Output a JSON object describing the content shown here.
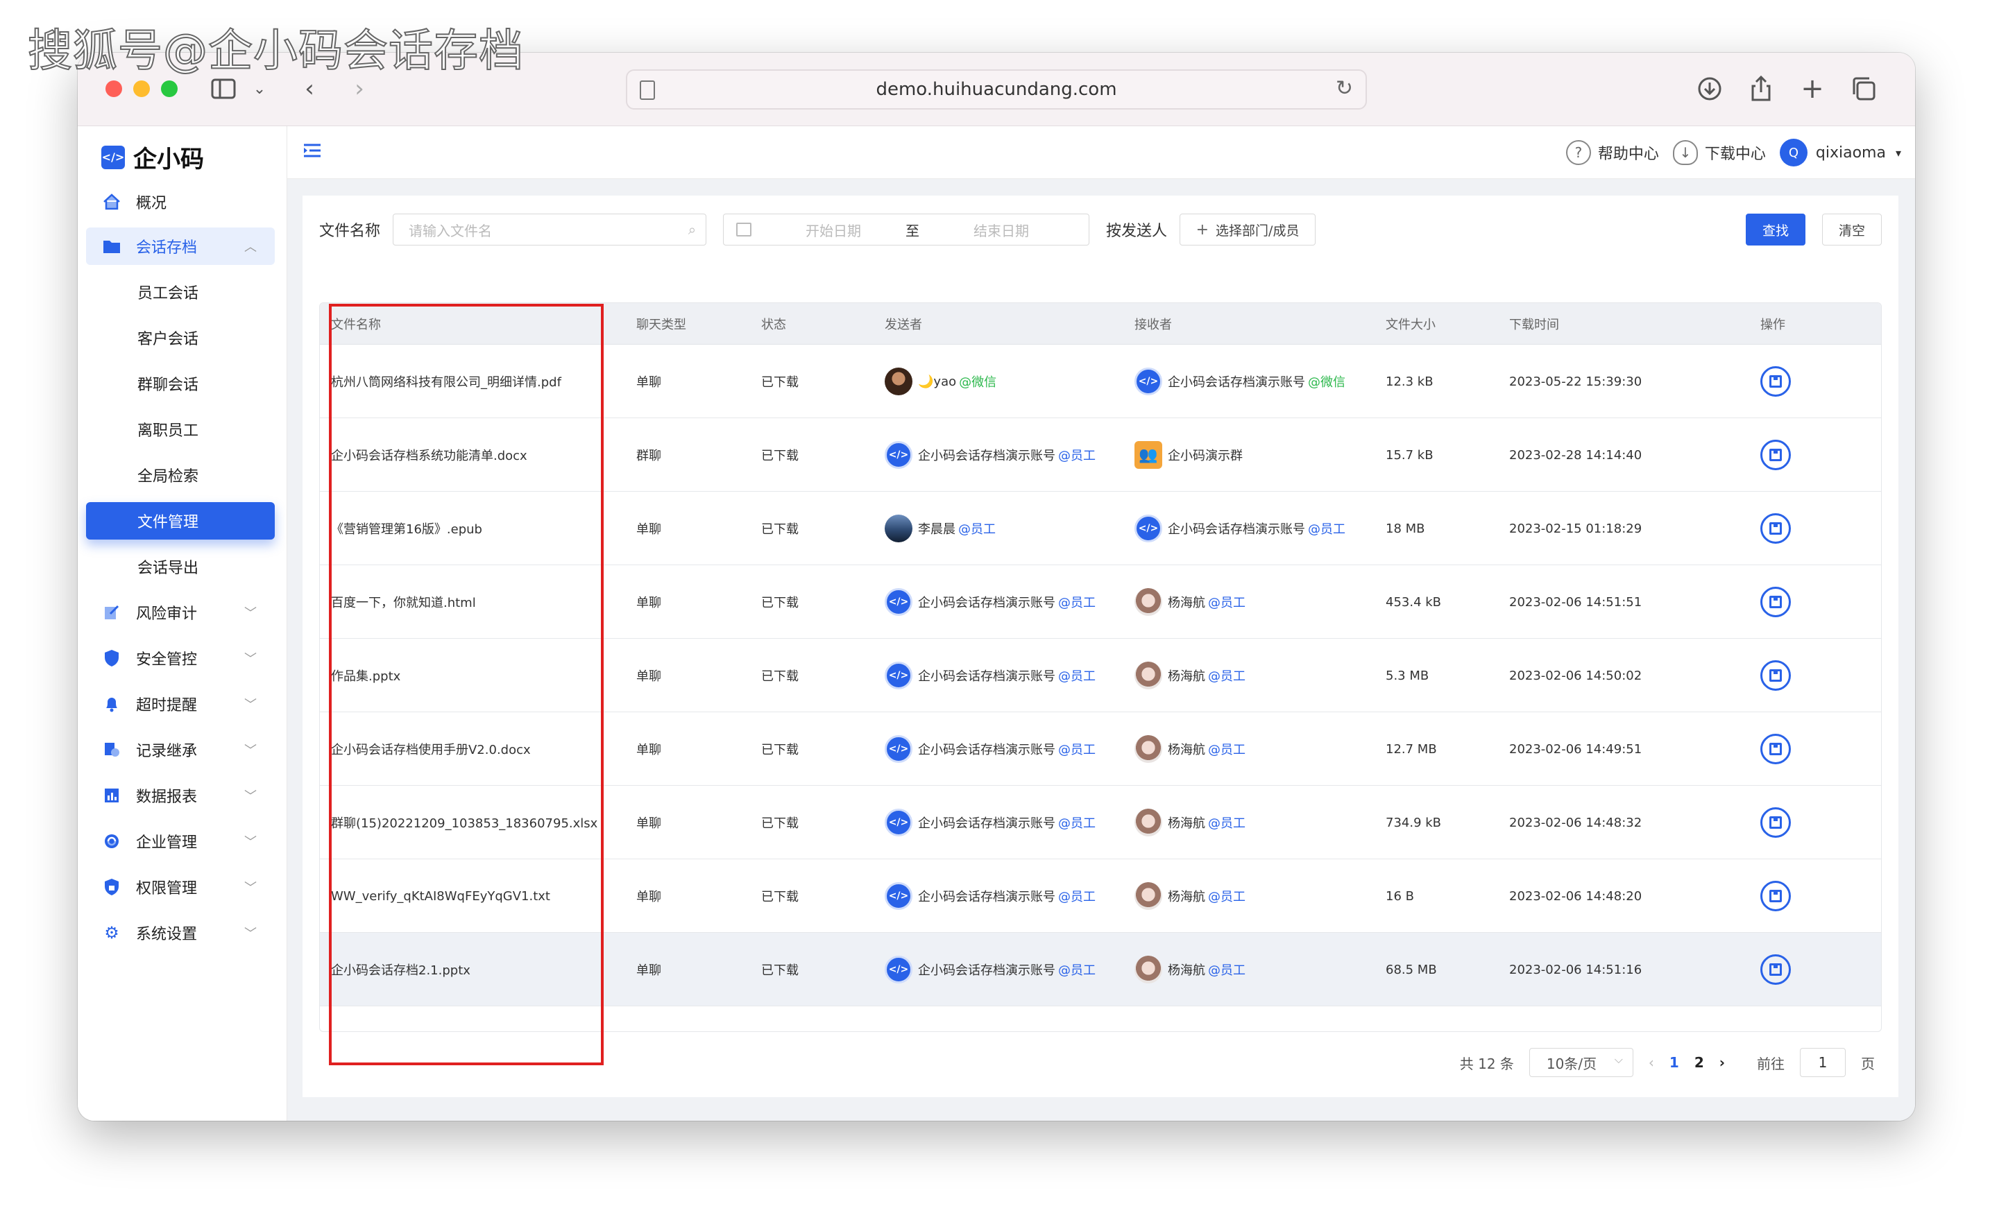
{
  "watermark": "搜狐号@企小码会话存档",
  "browser": {
    "url": "demo.huihuacundang.com",
    "icons": [
      "sidebar-icon",
      "chevron-down-icon",
      "back-icon",
      "forward-icon",
      "download-icon",
      "share-icon",
      "plus-icon",
      "tabs-icon",
      "reload-icon"
    ]
  },
  "app": {
    "logo_text": "企小码",
    "logo_mark": "</>"
  },
  "sidebar": {
    "items": [
      {
        "label": "概况",
        "icon": "home-icon"
      },
      {
        "label": "会话存档",
        "icon": "folder-icon"
      },
      {
        "label": "员工会话"
      },
      {
        "label": "客户会话"
      },
      {
        "label": "群聊会话"
      },
      {
        "label": "离职员工"
      },
      {
        "label": "全局检索"
      },
      {
        "label": "文件管理"
      },
      {
        "label": "会话导出"
      },
      {
        "label": "风险审计",
        "icon": "edit-icon"
      },
      {
        "label": "安全管控",
        "icon": "shield-icon"
      },
      {
        "label": "超时提醒",
        "icon": "bell-icon"
      },
      {
        "label": "记录继承",
        "icon": "transfer-icon"
      },
      {
        "label": "数据报表",
        "icon": "chart-icon"
      },
      {
        "label": "企业管理",
        "icon": "org-icon"
      },
      {
        "label": "权限管理",
        "icon": "lock-icon"
      },
      {
        "label": "系统设置",
        "icon": "gear-icon"
      }
    ]
  },
  "topbar": {
    "help": "帮助中心",
    "download": "下载中心",
    "avatar_letter": "Q",
    "user": "qixiaoma"
  },
  "filter": {
    "file_name_label": "文件名称",
    "file_name_placeholder": "请输入文件名",
    "start_date_placeholder": "开始日期",
    "date_sep": "至",
    "end_date_placeholder": "结束日期",
    "sender_label": "按发送人",
    "select_button": "选择部门/成员",
    "search_button": "查找",
    "clear_button": "清空"
  },
  "table": {
    "columns": [
      "文件名称",
      "聊天类型",
      "状态",
      "发送者",
      "接收者",
      "文件大小",
      "下载时间",
      "操作"
    ],
    "rows": [
      {
        "file": "杭州八筒网络科技有限公司_明细详情.pdf",
        "chat_type": "单聊",
        "status": "已下载",
        "sender": "🌙yao",
        "sender_tag": "@微信",
        "sender_avatar": "photo-brown",
        "receiver": "企小码会话存档演示账号",
        "receiver_tag": "@微信",
        "receiver_avatar": "brand",
        "size": "12.3 kB",
        "time": "2023-05-22 15:39:30"
      },
      {
        "file": "企小码会话存档系统功能清单.docx",
        "chat_type": "群聊",
        "status": "已下载",
        "sender": "企小码会话存档演示账号",
        "sender_tag": "@员工",
        "sender_avatar": "brand",
        "receiver": "企小码演示群",
        "receiver_tag": "",
        "receiver_avatar": "group",
        "size": "15.7 kB",
        "time": "2023-02-28 14:14:40"
      },
      {
        "file": "《营销管理第16版》.epub",
        "chat_type": "单聊",
        "status": "已下载",
        "sender": "李晨晨",
        "sender_tag": "@员工",
        "sender_avatar": "photo-sky",
        "receiver": "企小码会话存档演示账号",
        "receiver_tag": "@员工",
        "receiver_avatar": "brand",
        "size": "18 MB",
        "time": "2023-02-15 01:18:29"
      },
      {
        "file": "百度一下，你就知道.html",
        "chat_type": "单聊",
        "status": "已下载",
        "sender": "企小码会话存档演示账号",
        "sender_tag": "@员工",
        "sender_avatar": "brand",
        "receiver": "杨海航",
        "receiver_tag": "@员工",
        "receiver_avatar": "photo-girl",
        "size": "453.4 kB",
        "time": "2023-02-06 14:51:51"
      },
      {
        "file": "作品集.pptx",
        "chat_type": "单聊",
        "status": "已下载",
        "sender": "企小码会话存档演示账号",
        "sender_tag": "@员工",
        "sender_avatar": "brand",
        "receiver": "杨海航",
        "receiver_tag": "@员工",
        "receiver_avatar": "photo-girl",
        "size": "5.3 MB",
        "time": "2023-02-06 14:50:02"
      },
      {
        "file": "企小码会话存档使用手册V2.0.docx",
        "chat_type": "单聊",
        "status": "已下载",
        "sender": "企小码会话存档演示账号",
        "sender_tag": "@员工",
        "sender_avatar": "brand",
        "receiver": "杨海航",
        "receiver_tag": "@员工",
        "receiver_avatar": "photo-girl",
        "size": "12.7 MB",
        "time": "2023-02-06 14:49:51"
      },
      {
        "file": "群聊(15)20221209_103853_18360795.xlsx",
        "chat_type": "单聊",
        "status": "已下载",
        "sender": "企小码会话存档演示账号",
        "sender_tag": "@员工",
        "sender_avatar": "brand",
        "receiver": "杨海航",
        "receiver_tag": "@员工",
        "receiver_avatar": "photo-girl",
        "size": "734.9 kB",
        "time": "2023-02-06 14:48:32"
      },
      {
        "file": "WW_verify_qKtAI8WqFEyYqGV1.txt",
        "chat_type": "单聊",
        "status": "已下载",
        "sender": "企小码会话存档演示账号",
        "sender_tag": "@员工",
        "sender_avatar": "brand",
        "receiver": "杨海航",
        "receiver_tag": "@员工",
        "receiver_avatar": "photo-girl",
        "size": "16 B",
        "time": "2023-02-06 14:48:20"
      },
      {
        "file": "企小码会话存档2.1.pptx",
        "chat_type": "单聊",
        "status": "已下载",
        "sender": "企小码会话存档演示账号",
        "sender_tag": "@员工",
        "sender_avatar": "brand",
        "receiver": "杨海航",
        "receiver_tag": "@员工",
        "receiver_avatar": "photo-girl",
        "size": "68.5 MB",
        "time": "2023-02-06 14:51:16"
      }
    ]
  },
  "pagination": {
    "total": "共 12 条",
    "page_size": "10条/页",
    "pages": [
      "1",
      "2"
    ],
    "current": "1",
    "goto_label": "前往",
    "goto_value": "1",
    "page_suffix": "页"
  },
  "colors": {
    "accent": "#2962e8",
    "highlight_box": "#e02020",
    "wechat_tag": "#2db84d"
  }
}
